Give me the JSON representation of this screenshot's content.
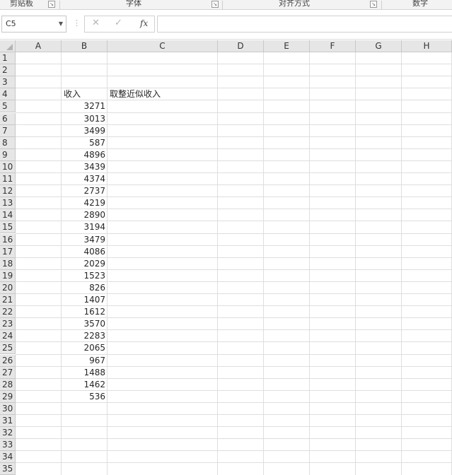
{
  "ribbon": {
    "groups": [
      "剪贴板",
      "字体",
      "对齐方式",
      "数字"
    ],
    "launcher_icon": "dialog-launcher-icon"
  },
  "formula_bar": {
    "name_box": "C5",
    "cancel_symbol": "✕",
    "enter_symbol": "✓",
    "fx_label": "fx",
    "formula": ""
  },
  "sheet": {
    "columns": [
      "A",
      "B",
      "C",
      "D",
      "E",
      "F",
      "G",
      "H"
    ],
    "rows": [
      "1",
      "2",
      "3",
      "4",
      "5",
      "6",
      "7",
      "8",
      "9",
      "10",
      "11",
      "12",
      "13",
      "14",
      "15",
      "16",
      "17",
      "18",
      "19",
      "20",
      "21",
      "22",
      "23",
      "24",
      "25",
      "26",
      "27",
      "28",
      "29",
      "30",
      "31",
      "32",
      "33",
      "34",
      "35"
    ],
    "header_b": "收入",
    "header_c": "取整近似收入",
    "values_b": [
      "3271",
      "3013",
      "3499",
      "587",
      "4896",
      "3439",
      "4374",
      "2737",
      "4219",
      "2890",
      "3194",
      "3479",
      "4086",
      "2029",
      "1523",
      "826",
      "1407",
      "1612",
      "3570",
      "2283",
      "2065",
      "967",
      "1488",
      "1462",
      "536"
    ]
  }
}
